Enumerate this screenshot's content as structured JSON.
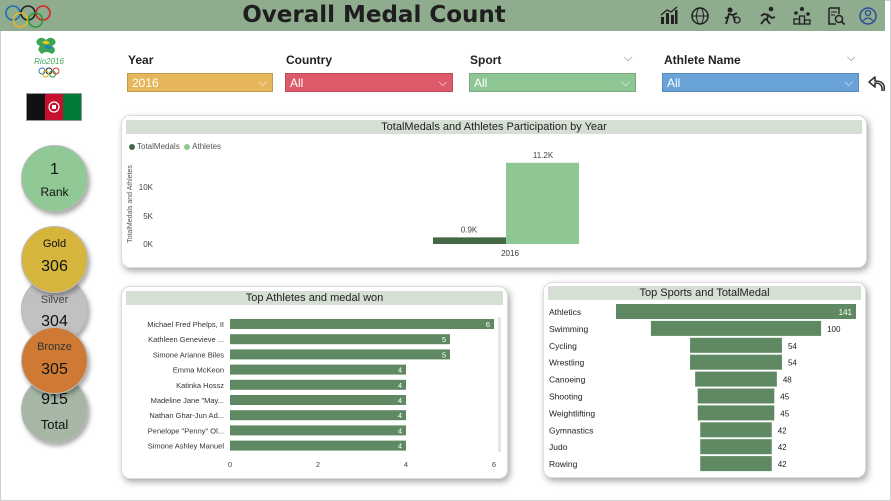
{
  "header": {
    "title": "Overall Medal Count"
  },
  "icons": [
    "olympic-rings-icon",
    "bar-chart-icon",
    "globe-icon",
    "athletes-icon",
    "runner-icon",
    "podium-icon",
    "search-report-icon",
    "rio-emblem-icon"
  ],
  "rio_logo_text": "Rio2016",
  "flag_colors": [
    "#111111",
    "#c8102e",
    "#007a36"
  ],
  "kpis": {
    "rank": {
      "value": "1",
      "label": "Rank"
    },
    "gold": {
      "value": "306",
      "label": "Gold"
    },
    "silver": {
      "value": "304",
      "label": "Silver"
    },
    "bronze": {
      "value": "305",
      "label": "Bronze"
    },
    "total": {
      "value": "915",
      "label": "Total"
    }
  },
  "filters": {
    "year": {
      "label": "Year",
      "value": "2016",
      "color": "#e5b75a"
    },
    "country": {
      "label": "Country",
      "value": "All",
      "color": "#dd5a6a"
    },
    "sport": {
      "label": "Sport",
      "value": "All",
      "color": "#8fc794"
    },
    "athlete": {
      "label": "Athlete Name",
      "value": "All",
      "color": "#6aa3da"
    }
  },
  "charts": {
    "participation": {
      "title": "TotalMedals and Athletes Participation by Year",
      "legend": [
        "TotalMedals",
        "Athletes"
      ],
      "ylabel": "TotalMedals and Athletes",
      "ticks": [
        "10K",
        "5K",
        "0K"
      ],
      "category": "2016",
      "labels": [
        "0.9K",
        "11.2K"
      ]
    },
    "athletes": {
      "title": "Top Athletes and medal won",
      "xticks": [
        "0",
        "2",
        "4",
        "6"
      ]
    },
    "sports": {
      "title": "Top Sports and TotalMedal"
    }
  },
  "chart_data": [
    {
      "type": "bar",
      "title": "TotalMedals and Athletes Participation by Year",
      "categories": [
        "2016"
      ],
      "series": [
        {
          "name": "TotalMedals",
          "values": [
            915
          ],
          "color": "#456846"
        },
        {
          "name": "Athletes",
          "values": [
            11200
          ],
          "color": "#8fc794"
        }
      ],
      "xlabel": "",
      "ylabel": "TotalMedals and Athletes",
      "ylim": [
        0,
        12000
      ]
    },
    {
      "type": "bar",
      "title": "Top Athletes and medal won",
      "categories": [
        "Michael Fred Phelps, II",
        "Kathleen Genevieve ...",
        "Simone Arianne Biles",
        "Emma McKeon",
        "Katinka Hossz",
        "Madeline Jane \"May...",
        "Nathan Ghar-Jun Ad...",
        "Penelope \"Penny\" Ol...",
        "Simone Ashley Manuel"
      ],
      "values": [
        6,
        5,
        5,
        4,
        4,
        4,
        4,
        4,
        4
      ],
      "xlim": [
        0,
        6
      ],
      "color": "#5f8963"
    },
    {
      "type": "bar",
      "title": "Top Sports and TotalMedal",
      "categories": [
        "Athletics",
        "Swimming",
        "Cycling",
        "Wrestling",
        "Canoeing",
        "Shooting",
        "Weightlifting",
        "Gymnastics",
        "Judo",
        "Rowing"
      ],
      "values": [
        141,
        100,
        54,
        54,
        48,
        45,
        45,
        42,
        42,
        42
      ],
      "color": "#5f8963"
    }
  ]
}
